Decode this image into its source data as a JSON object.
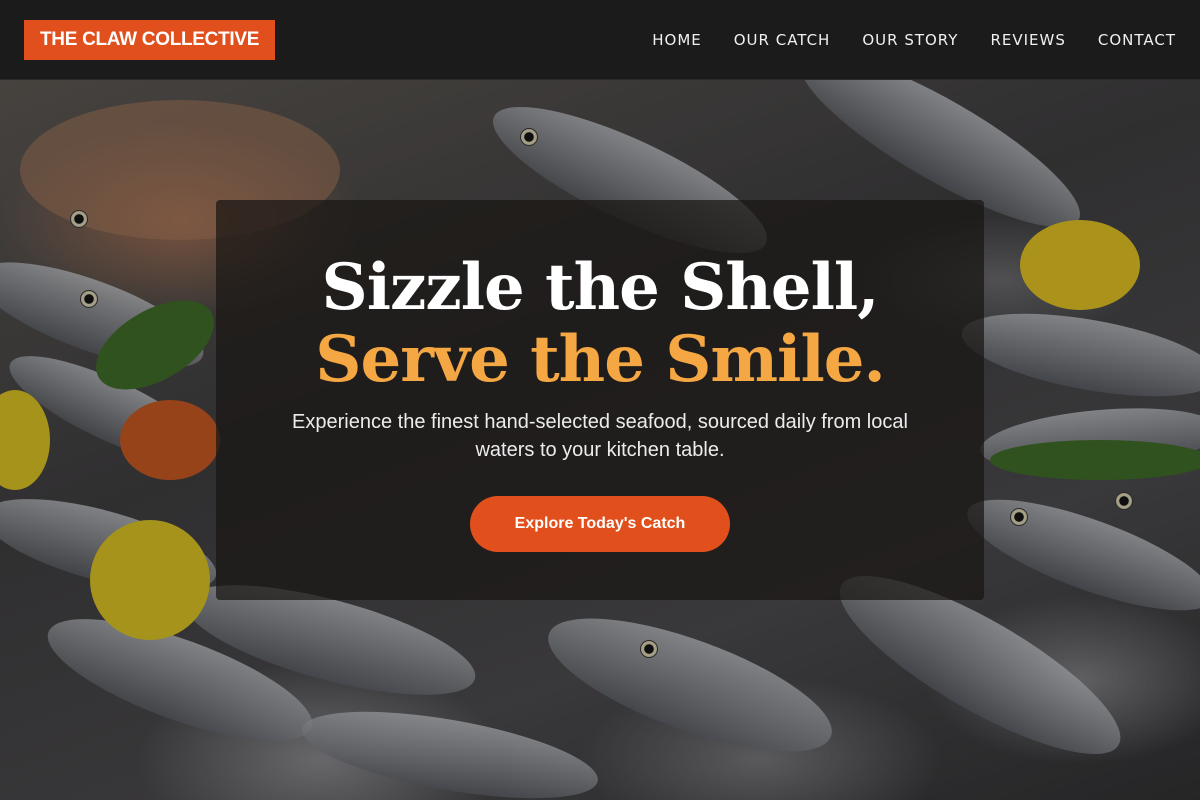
{
  "brand": {
    "name": "THE CLAW COLLECTIVE",
    "accent": "#e04f1c"
  },
  "nav": {
    "items": [
      {
        "label": "HOME"
      },
      {
        "label": "OUR CATCH"
      },
      {
        "label": "OUR STORY"
      },
      {
        "label": "REVIEWS"
      },
      {
        "label": "CONTACT"
      }
    ]
  },
  "hero": {
    "headline_line1": "Sizzle the Shell,",
    "headline_line2": "Serve the Smile.",
    "headline_accent": "#f4a743",
    "subtitle": "Experience the finest hand-selected seafood, sourced daily from local waters to your kitchen table.",
    "cta_label": "Explore Today's Catch"
  }
}
